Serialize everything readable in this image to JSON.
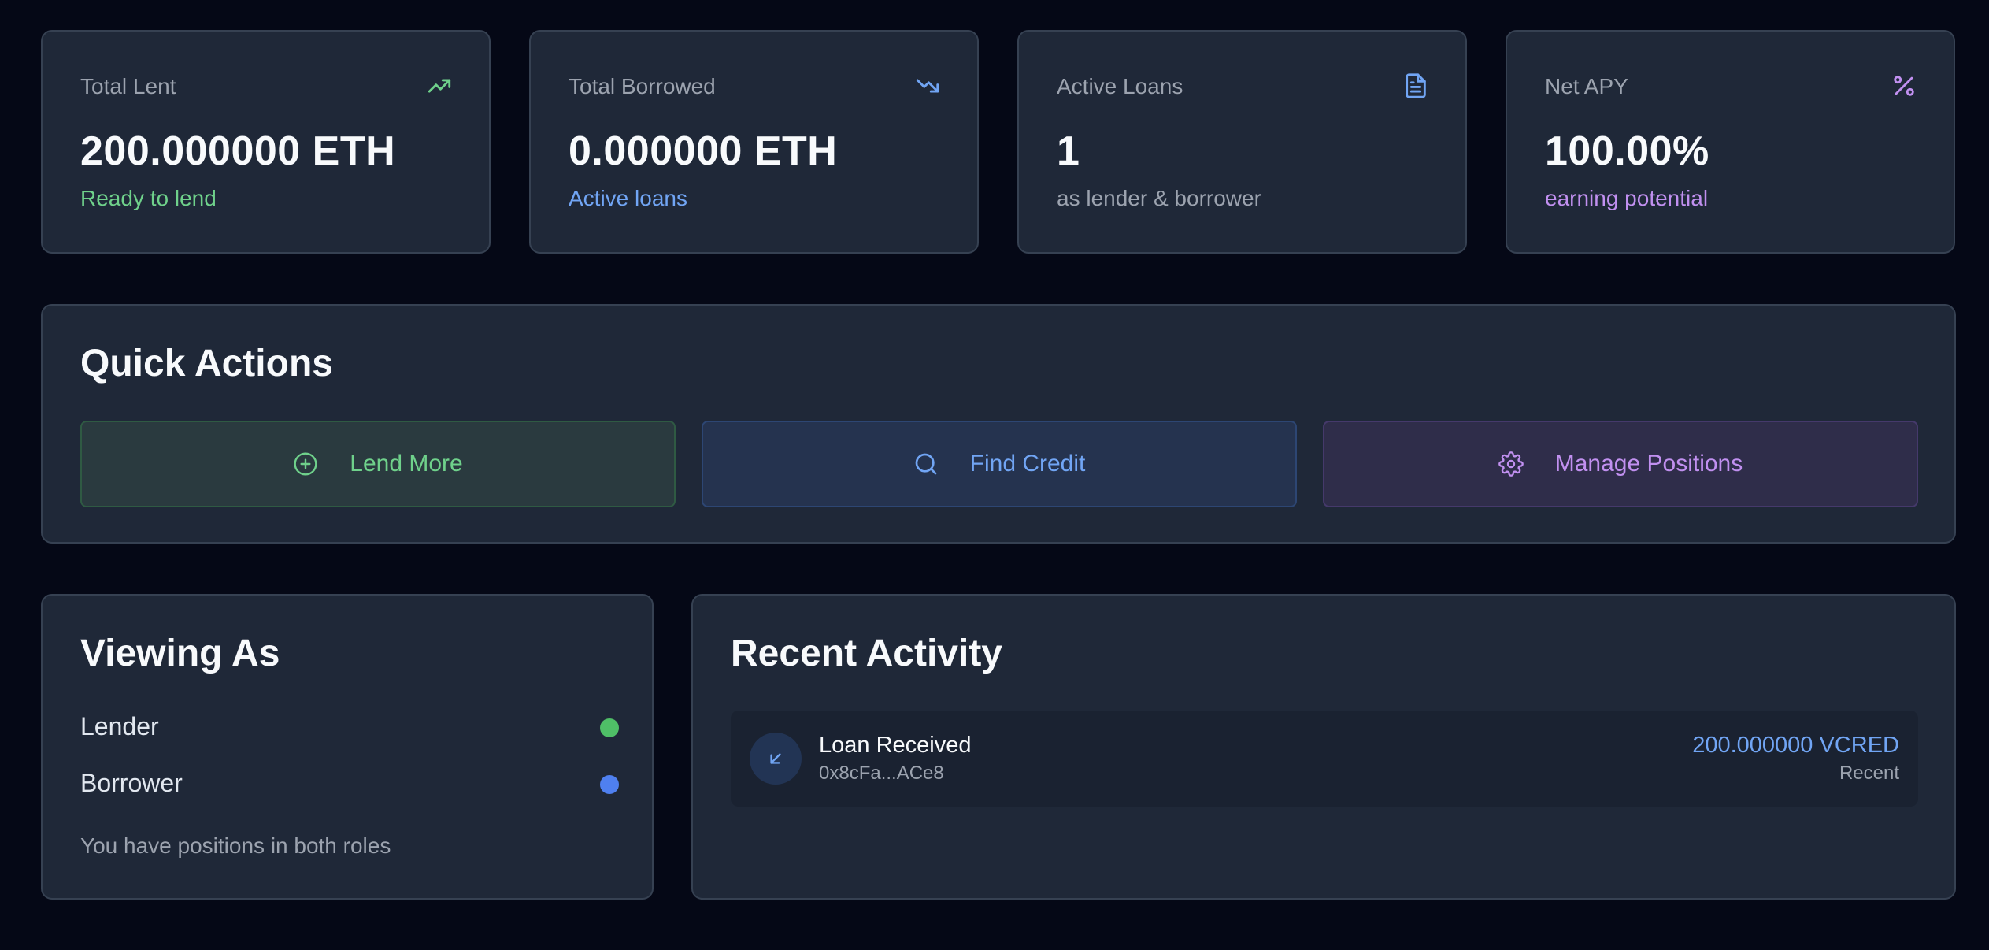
{
  "stats": [
    {
      "label": "Total Lent",
      "value": "200.000000 ETH",
      "sub": "Ready to lend",
      "sub_color": "#6fd18b",
      "icon": "trending-up-icon",
      "icon_color": "#6fd18b"
    },
    {
      "label": "Total Borrowed",
      "value": "0.000000 ETH",
      "sub": "Active loans",
      "sub_color": "#71a5f4",
      "icon": "trending-down-icon",
      "icon_color": "#71a5f4"
    },
    {
      "label": "Active Loans",
      "value": "1",
      "sub": "as lender & borrower",
      "sub_color": "#9ca3af",
      "icon": "document-icon",
      "icon_color": "#71a5f4"
    },
    {
      "label": "Net APY",
      "value": "100.00%",
      "sub": "earning potential",
      "sub_color": "#c190f0",
      "icon": "percent-icon",
      "icon_color": "#c190f0"
    }
  ],
  "quick_actions": {
    "title": "Quick Actions",
    "actions": [
      {
        "label": "Lend More",
        "icon": "plus-circle-icon"
      },
      {
        "label": "Find Credit",
        "icon": "search-icon"
      },
      {
        "label": "Manage Positions",
        "icon": "gear-icon"
      }
    ]
  },
  "viewing_as": {
    "title": "Viewing As",
    "roles": [
      {
        "label": "Lender",
        "dot_color": "#4fbf67"
      },
      {
        "label": "Borrower",
        "dot_color": "#4f80f0"
      }
    ],
    "note": "You have positions in both roles"
  },
  "recent_activity": {
    "title": "Recent Activity",
    "items": [
      {
        "title": "Loan Received",
        "address": "0x8cFa...ACe8",
        "amount": "200.000000 VCRED",
        "time": "Recent",
        "icon": "arrow-down-left-icon"
      }
    ]
  }
}
